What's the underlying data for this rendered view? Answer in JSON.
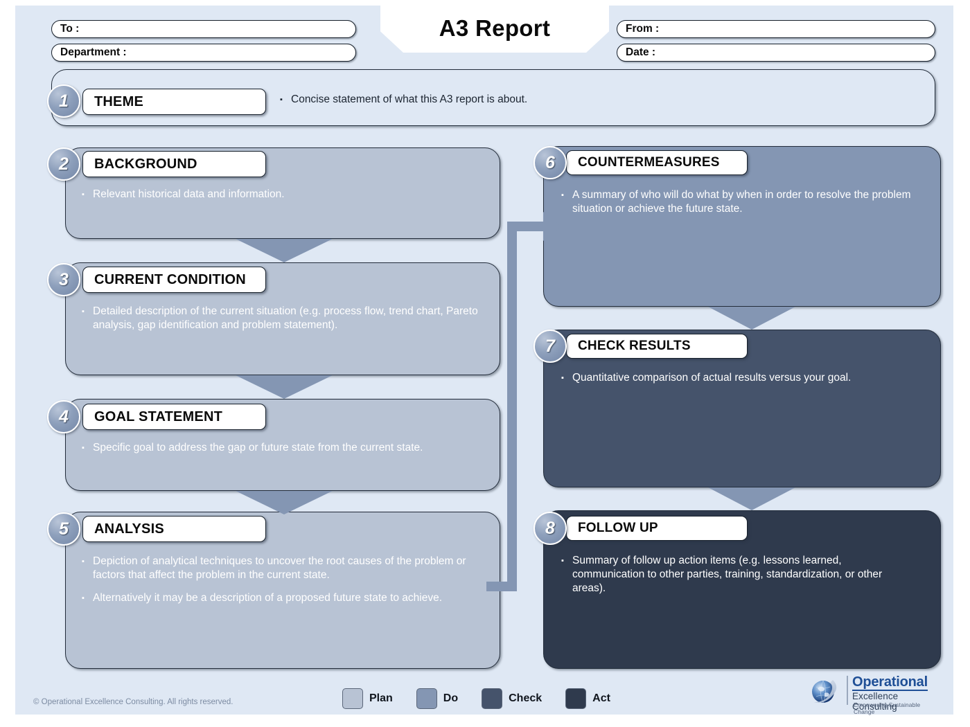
{
  "header": {
    "title": "A3 Report",
    "fields": [
      {
        "label": "To :"
      },
      {
        "label": "Department :"
      },
      {
        "label": "From :"
      },
      {
        "label": "Date :"
      }
    ]
  },
  "sections": [
    {
      "number": "1",
      "title": "THEME",
      "phase": "plan",
      "bullets": [
        "Concise statement of what this A3 report is about."
      ]
    },
    {
      "number": "2",
      "title": "BACKGROUND",
      "phase": "plan",
      "bullets": [
        "Relevant historical data and information."
      ]
    },
    {
      "number": "3",
      "title": "CURRENT CONDITION",
      "phase": "plan",
      "bullets": [
        "Detailed description of the current situation (e.g. process flow, trend chart, Pareto analysis, gap identification and problem statement)."
      ]
    },
    {
      "number": "4",
      "title": "GOAL STATEMENT",
      "phase": "plan",
      "bullets": [
        "Specific goal to address the gap or future state from the current state."
      ]
    },
    {
      "number": "5",
      "title": "ANALYSIS",
      "phase": "plan",
      "bullets": [
        "Depiction of analytical techniques to uncover the root causes of the problem or factors that affect the problem in the current state.",
        "Alternatively it may be a description of a proposed future state to achieve."
      ]
    },
    {
      "number": "6",
      "title": "COUNTERMEASURES",
      "phase": "do",
      "bullets": [
        "A summary of who will do what by when in order to resolve the problem situation or achieve the future state."
      ]
    },
    {
      "number": "7",
      "title": "CHECK RESULTS",
      "phase": "check",
      "bullets": [
        "Quantitative comparison of actual results versus your goal."
      ]
    },
    {
      "number": "8",
      "title": "FOLLOW UP",
      "phase": "act",
      "bullets": [
        "Summary of follow up action items (e.g. lessons learned, communication to other parties, training, standardization, or other areas)."
      ]
    }
  ],
  "legend": [
    {
      "label": "Plan",
      "color": "#b8c3d4"
    },
    {
      "label": "Do",
      "color": "#8496b3"
    },
    {
      "label": "Check",
      "color": "#45536b"
    },
    {
      "label": "Act",
      "color": "#2f3a4d"
    }
  ],
  "footer": {
    "copyright": "© Operational Excellence Consulting. All rights reserved."
  },
  "logo": {
    "line1": "Operational",
    "line2": "Excellence Consulting",
    "tagline": "Empowering Sustainable Change"
  },
  "bullet_glyph": "▪"
}
